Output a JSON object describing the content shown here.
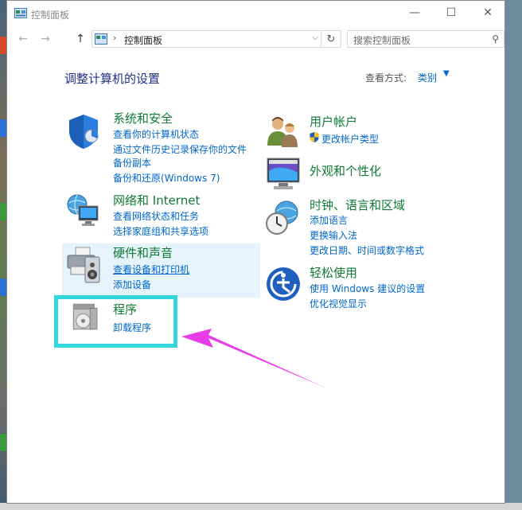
{
  "window": {
    "title": "控制面板",
    "controls": {
      "minimize": "—",
      "maximize": "☐",
      "close": "✕"
    }
  },
  "nav": {
    "back": "←",
    "forward": "→",
    "up": "↑",
    "breadcrumb_sep": "›",
    "address_path": "控制面板",
    "dropdown": "⌵",
    "refresh": "↻",
    "search_placeholder": "搜索控制面板",
    "search_glyph": "⚲"
  },
  "main": {
    "heading": "调整计算机的设置",
    "view_by_label": "查看方式:",
    "view_by_value": "类别",
    "view_by_arrow": "▼"
  },
  "categories_left": [
    {
      "title": "系统和安全",
      "links": [
        "查看你的计算机状态",
        "通过文件历史记录保存你的文件",
        "备份副本",
        "备份和还原(Windows 7)"
      ]
    },
    {
      "title": "网络和 Internet",
      "links": [
        "查看网络状态和任务",
        "选择家庭组和共享选项"
      ]
    },
    {
      "title": "硬件和声音",
      "links": [
        "查看设备和打印机",
        "添加设备"
      ]
    },
    {
      "title": "程序",
      "links": [
        "卸载程序"
      ]
    }
  ],
  "categories_right": [
    {
      "title": "用户帐户",
      "links": [
        "更改帐户类型"
      ]
    },
    {
      "title": "外观和个性化",
      "links": []
    },
    {
      "title": "时钟、语言和区域",
      "links": [
        "添加语言",
        "更换输入法",
        "更改日期、时间或数字格式"
      ]
    },
    {
      "title": "轻松使用",
      "links": [
        "使用 Windows 建议的设置",
        "优化视觉显示"
      ]
    }
  ],
  "colors": {
    "highlight_box": "#33d6dc",
    "arrow": "#e83ce8",
    "category_title": "#0e7a33",
    "link": "#0066cc"
  }
}
